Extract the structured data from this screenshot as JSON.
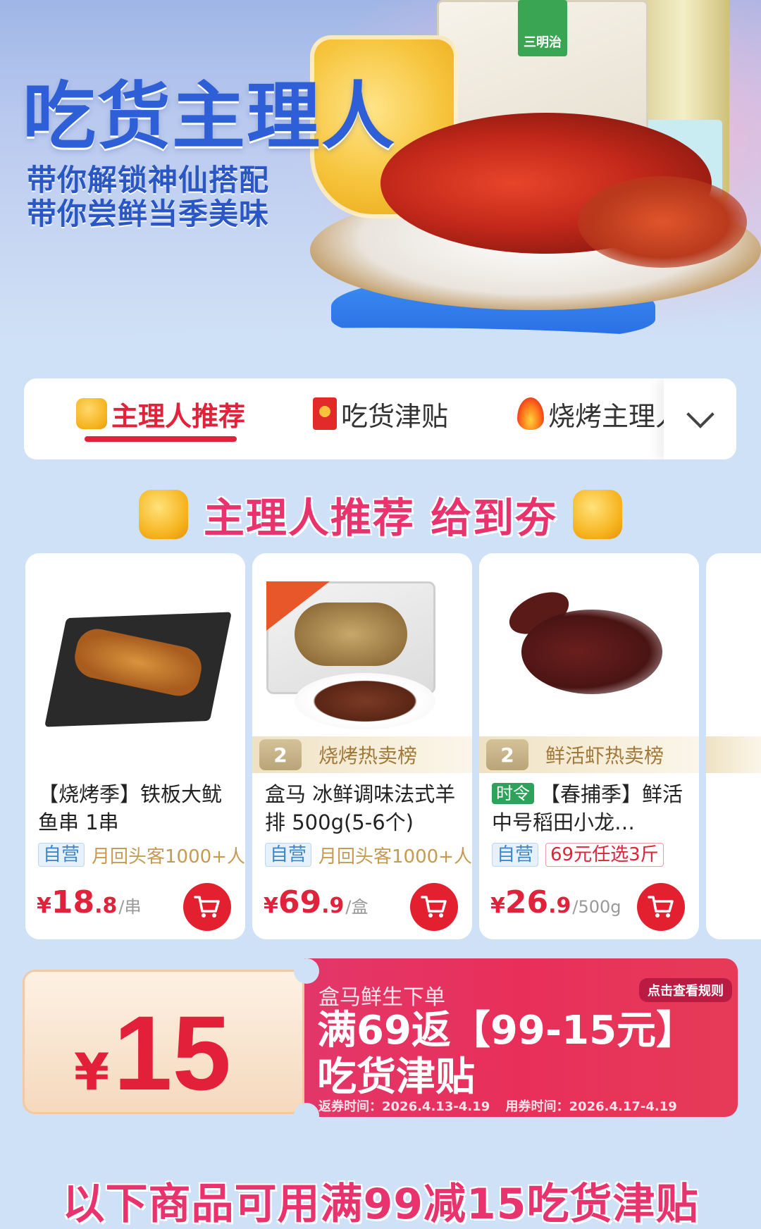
{
  "hero": {
    "title": "吃货主理人",
    "subtitle_line1": "带你解锁神仙搭配",
    "subtitle_line2": "带你尝鲜当季美味",
    "box_tag": "三明治"
  },
  "tabs": [
    {
      "label": "主理人推荐",
      "icon": "thumbs-up-icon",
      "active": true
    },
    {
      "label": "吃货津贴",
      "icon": "red-envelope-icon",
      "active": false
    },
    {
      "label": "烧烤主理人",
      "icon": "fire-icon",
      "active": false
    }
  ],
  "section": {
    "heading": "主理人推荐 给到夯"
  },
  "products": [
    {
      "title": "【烧烤季】铁板大鱿鱼串 1串",
      "rank_text": "",
      "tag_self": "自营",
      "tag_note": "月回头客1000+人",
      "price_symbol": "¥",
      "price_int": "18",
      "price_dec": ".8",
      "unit": "/串"
    },
    {
      "title": "盒马 冰鲜调味法式羊排 500g(5-6个)",
      "rank_number": "2",
      "rank_text": "烧烤热卖榜",
      "tag_self": "自营",
      "tag_note": "月回头客1000+人",
      "price_symbol": "¥",
      "price_int": "69",
      "price_dec": ".9",
      "unit": "/盒"
    },
    {
      "title_badge": "时令",
      "title": "【春捕季】鲜活 中号稻田小龙…",
      "rank_number": "2",
      "rank_text": "鲜活虾热卖榜",
      "tag_self": "自营",
      "tag_promo": "69元任选3斤",
      "price_symbol": "¥",
      "price_int": "26",
      "price_dec": ".9",
      "unit": "/500g"
    }
  ],
  "coupon": {
    "symbol": "¥",
    "amount": "15",
    "subhead": "盒马鲜生下单",
    "rule_link": "点击查看规则",
    "main_line1": "满69返【99-15元】",
    "main_line2": "吃货津贴",
    "return_time": "返券时间：2026.4.13-4.19",
    "use_time": "用券时间：2026.4.17-4.19"
  },
  "footer": {
    "headline": "以下商品可用满99减15吃货津贴"
  },
  "colors": {
    "accent_red": "#e0223a",
    "headline_pink": "#e8336f",
    "hero_blue": "#2f5fd6",
    "page_bg": "#cfe1f6"
  }
}
